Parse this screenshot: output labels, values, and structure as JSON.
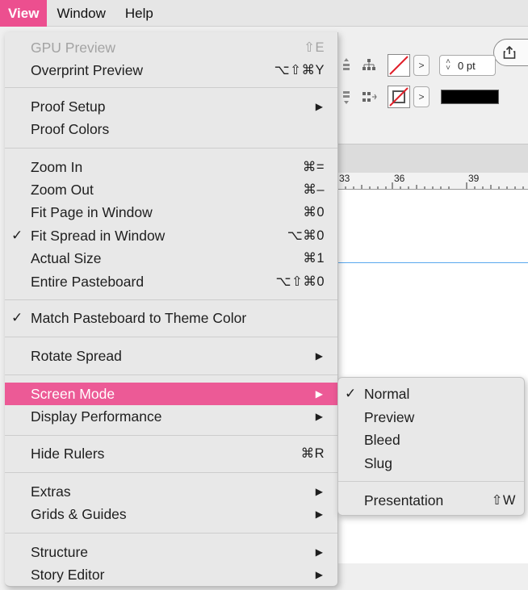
{
  "menubar": {
    "items": [
      "View",
      "Window",
      "Help"
    ]
  },
  "view_menu": {
    "gpu_preview": {
      "label": "GPU Preview",
      "shortcut": "⇧E"
    },
    "overprint_preview": {
      "label": "Overprint Preview",
      "shortcut": "⌥⇧⌘Y"
    },
    "proof_setup": {
      "label": "Proof Setup"
    },
    "proof_colors": {
      "label": "Proof Colors"
    },
    "zoom_in": {
      "label": "Zoom In",
      "shortcut": "⌘="
    },
    "zoom_out": {
      "label": "Zoom Out",
      "shortcut": "⌘–"
    },
    "fit_page": {
      "label": "Fit Page in Window",
      "shortcut": "⌘0"
    },
    "fit_spread": {
      "label": "Fit Spread in Window",
      "shortcut": "⌥⌘0",
      "check": "✓"
    },
    "actual_size": {
      "label": "Actual Size",
      "shortcut": "⌘1"
    },
    "entire_pasteboard": {
      "label": "Entire Pasteboard",
      "shortcut": "⌥⇧⌘0"
    },
    "match_pasteboard": {
      "label": "Match Pasteboard to Theme Color",
      "check": "✓"
    },
    "rotate_spread": {
      "label": "Rotate Spread"
    },
    "screen_mode": {
      "label": "Screen Mode"
    },
    "display_performance": {
      "label": "Display Performance"
    },
    "hide_rulers": {
      "label": "Hide Rulers",
      "shortcut": "⌘R"
    },
    "extras": {
      "label": "Extras"
    },
    "grids_guides": {
      "label": "Grids & Guides"
    },
    "structure": {
      "label": "Structure"
    },
    "story_editor": {
      "label": "Story Editor"
    },
    "submenu_arrow": "▶"
  },
  "screen_mode_submenu": {
    "normal": {
      "label": "Normal",
      "check": "✓"
    },
    "preview": {
      "label": "Preview"
    },
    "bleed": {
      "label": "Bleed"
    },
    "slug": {
      "label": "Slug"
    },
    "presentation": {
      "label": "Presentation",
      "shortcut": "⇧W"
    }
  },
  "background_app": {
    "stroke_weight": "0 pt",
    "ruler_labels": [
      "33",
      "36",
      "39"
    ],
    "stepper_up": "˄",
    "stepper_down": "˅",
    "arrow": ">"
  },
  "colors": {
    "highlight": "#ec5a96",
    "menubar_active": "#ec4f8f",
    "guide": "#5aa8ee"
  }
}
